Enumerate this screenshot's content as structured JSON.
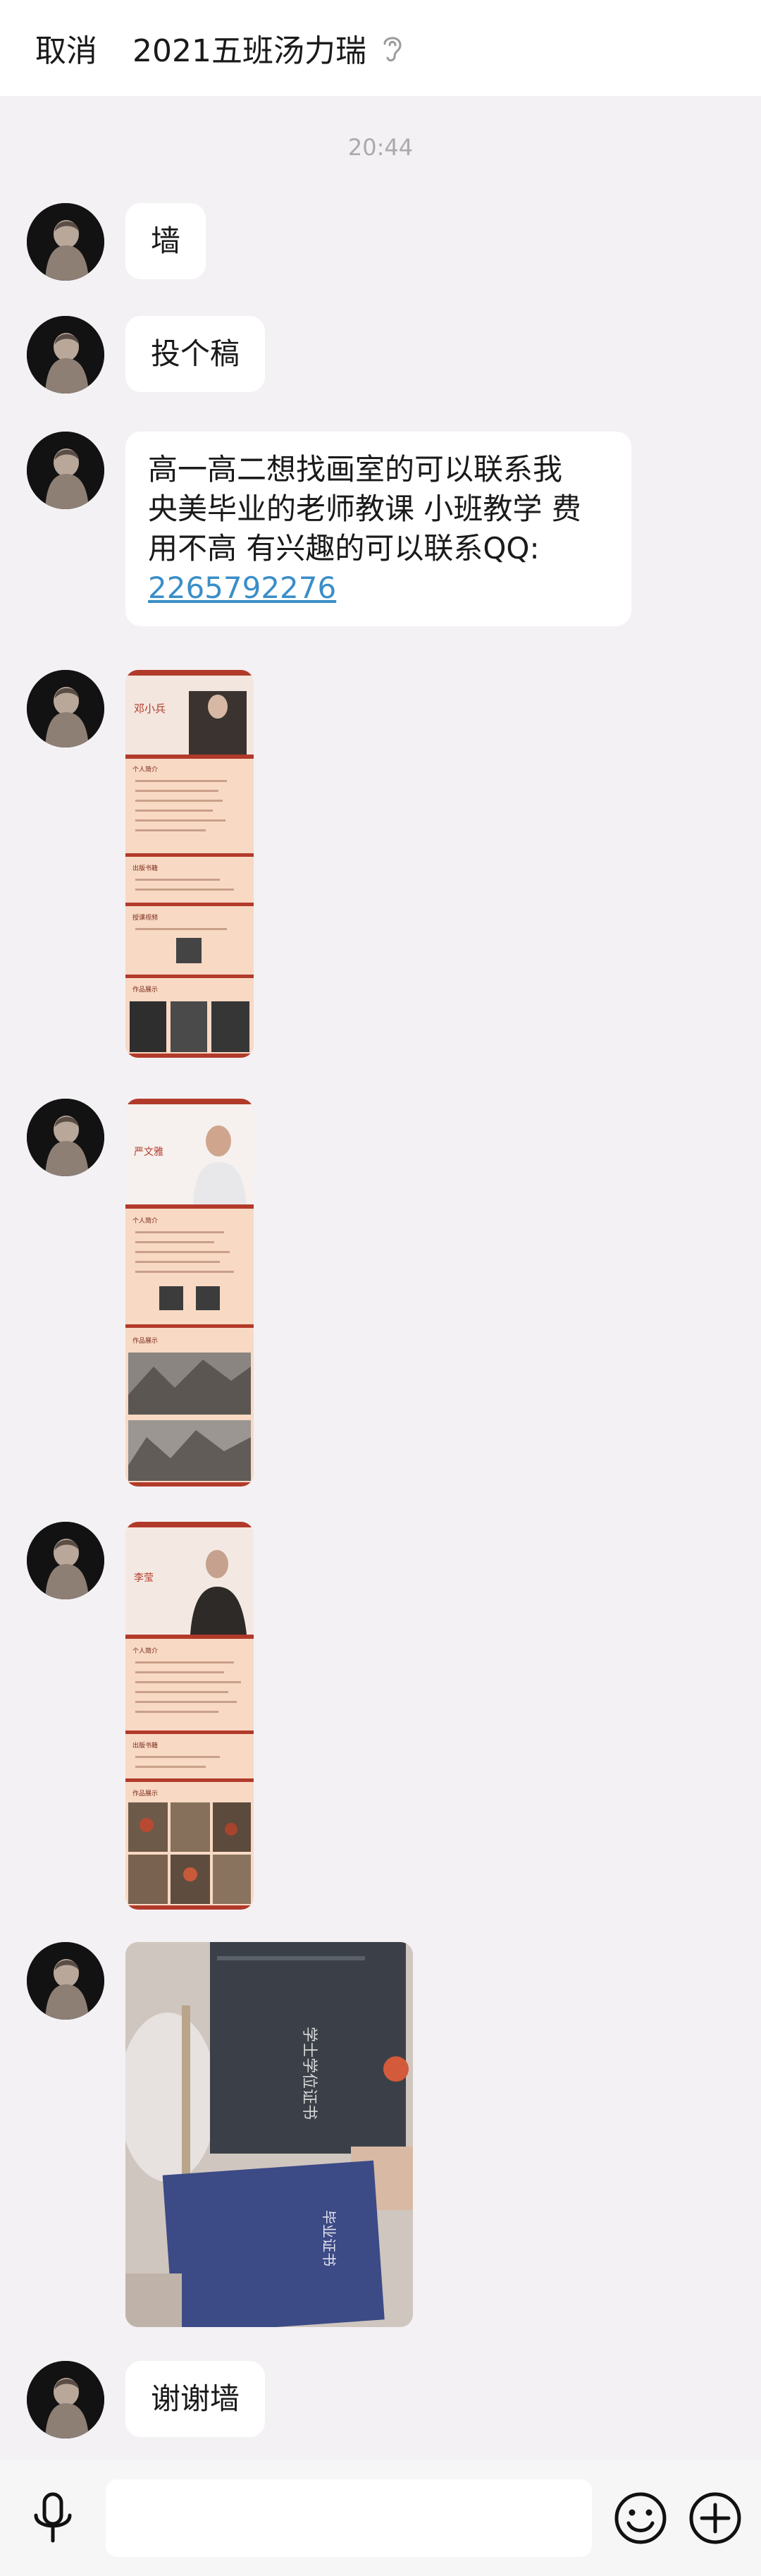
{
  "header": {
    "cancel_label": "取消",
    "title": "2021五班汤力瑞",
    "ear_icon": "ear-icon"
  },
  "chat": {
    "timestamp": "20:44",
    "messages": [
      {
        "type": "text",
        "text": "墙"
      },
      {
        "type": "text",
        "text": "投个稿"
      },
      {
        "type": "text",
        "line1": "高一高二想找画室的可以联系我",
        "line2": "央美毕业的老师教课 小班教学 费",
        "line3": "用不高 有兴趣的可以联系QQ:",
        "link": "2265792276"
      },
      {
        "type": "image",
        "name": "teacher-poster-1"
      },
      {
        "type": "image",
        "name": "teacher-poster-2"
      },
      {
        "type": "image",
        "name": "teacher-poster-3"
      },
      {
        "type": "image",
        "name": "certificate-photo"
      },
      {
        "type": "text",
        "text": "谢谢墙"
      }
    ]
  },
  "poster1": {
    "name": "邓小兵",
    "sections": [
      "个人简介",
      "出版书籍",
      "授课视频",
      "作品展示"
    ]
  },
  "poster2": {
    "name": "严文雅",
    "sections": [
      "个人简介",
      "作品展示"
    ]
  },
  "poster3": {
    "name": "李莹",
    "sections": [
      "个人简介",
      "出版书籍",
      "作品展示"
    ]
  },
  "certificate": {
    "title_vertical_1": "学士学位证书",
    "title_vertical_2": "毕业证书"
  },
  "inputbar": {
    "mic_icon": "microphone-icon",
    "emoji_icon": "emoji-icon",
    "plus_icon": "plus-icon"
  },
  "colors": {
    "background": "#f3f1f4",
    "bubble": "#ffffff",
    "link": "#3a8ec8",
    "poster_red": "#b23a2a",
    "poster_peach": "#f8d9c4"
  }
}
